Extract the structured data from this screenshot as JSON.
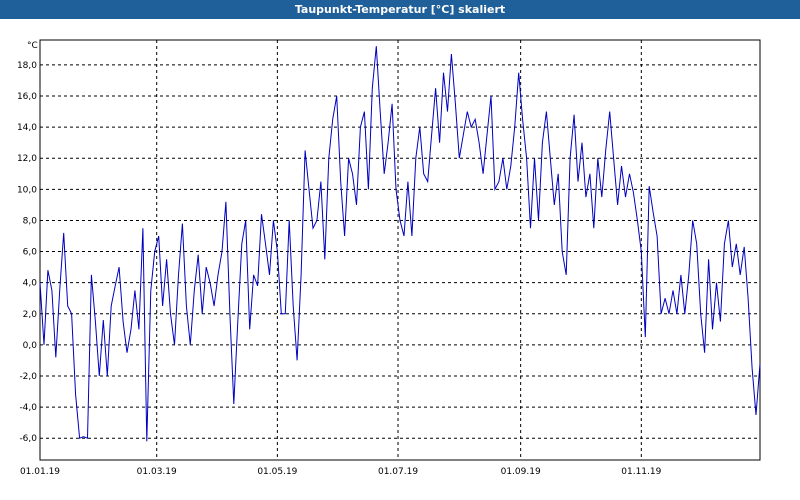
{
  "window": {
    "title": "Taupunkt-Temperatur [°C] skaliert"
  },
  "chart_data": {
    "type": "line",
    "title": "Taupunkt-Temperatur [°C] skaliert",
    "y_unit": "°C",
    "ylim": [
      -7.4,
      19.6
    ],
    "y_ticks": [
      "18,0",
      "16,0",
      "14,0",
      "12,0",
      "10,0",
      "8,0",
      "6,0",
      "4,0",
      "2,0",
      "0,0",
      "-2,0",
      "-4,0",
      "-6,0"
    ],
    "x_ticks": [
      "01.01.19",
      "01.03.19",
      "01.05.19",
      "01.07.19",
      "01.09.19",
      "01.11.19"
    ],
    "grid": true,
    "series": [
      {
        "color": "#0000c0",
        "points": [
          [
            "2019-01-01",
            4.0
          ],
          [
            "2019-01-03",
            0.0
          ],
          [
            "2019-01-05",
            4.8
          ],
          [
            "2019-01-07",
            3.5
          ],
          [
            "2019-01-09",
            -0.8
          ],
          [
            "2019-01-11",
            3.6
          ],
          [
            "2019-01-13",
            7.2
          ],
          [
            "2019-01-15",
            2.5
          ],
          [
            "2019-01-17",
            2.0
          ],
          [
            "2019-01-19",
            -3.2
          ],
          [
            "2019-01-21",
            -6.0
          ],
          [
            "2019-01-23",
            -5.9
          ],
          [
            "2019-01-25",
            -6.0
          ],
          [
            "2019-01-27",
            4.5
          ],
          [
            "2019-01-29",
            1.5
          ],
          [
            "2019-01-31",
            -2.0
          ],
          [
            "2019-02-02",
            1.6
          ],
          [
            "2019-02-04",
            -2.0
          ],
          [
            "2019-02-06",
            2.5
          ],
          [
            "2019-02-08",
            3.8
          ],
          [
            "2019-02-10",
            5.0
          ],
          [
            "2019-02-12",
            1.5
          ],
          [
            "2019-02-14",
            -0.5
          ],
          [
            "2019-02-16",
            1.0
          ],
          [
            "2019-02-18",
            3.5
          ],
          [
            "2019-02-20",
            1.0
          ],
          [
            "2019-02-22",
            7.5
          ],
          [
            "2019-02-24",
            -6.2
          ],
          [
            "2019-02-26",
            3.5
          ],
          [
            "2019-02-28",
            6.0
          ],
          [
            "2019-03-02",
            7.0
          ],
          [
            "2019-03-04",
            2.5
          ],
          [
            "2019-03-06",
            5.5
          ],
          [
            "2019-03-08",
            2.0
          ],
          [
            "2019-03-10",
            0.0
          ],
          [
            "2019-03-12",
            4.5
          ],
          [
            "2019-03-14",
            7.8
          ],
          [
            "2019-03-16",
            2.5
          ],
          [
            "2019-03-18",
            0.0
          ],
          [
            "2019-03-20",
            3.5
          ],
          [
            "2019-03-22",
            5.8
          ],
          [
            "2019-03-24",
            2.0
          ],
          [
            "2019-03-26",
            5.0
          ],
          [
            "2019-03-28",
            4.0
          ],
          [
            "2019-03-30",
            2.5
          ],
          [
            "2019-04-01",
            4.5
          ],
          [
            "2019-04-03",
            6.0
          ],
          [
            "2019-04-05",
            9.2
          ],
          [
            "2019-04-07",
            2.0
          ],
          [
            "2019-04-09",
            -3.8
          ],
          [
            "2019-04-11",
            1.5
          ],
          [
            "2019-04-13",
            6.5
          ],
          [
            "2019-04-15",
            8.0
          ],
          [
            "2019-04-17",
            1.0
          ],
          [
            "2019-04-19",
            4.5
          ],
          [
            "2019-04-21",
            3.8
          ],
          [
            "2019-04-23",
            8.4
          ],
          [
            "2019-04-25",
            6.5
          ],
          [
            "2019-04-27",
            4.5
          ],
          [
            "2019-04-29",
            8.0
          ],
          [
            "2019-05-01",
            6.0
          ],
          [
            "2019-05-03",
            2.0
          ],
          [
            "2019-05-05",
            2.0
          ],
          [
            "2019-05-07",
            8.0
          ],
          [
            "2019-05-09",
            2.5
          ],
          [
            "2019-05-11",
            -1.0
          ],
          [
            "2019-05-13",
            4.5
          ],
          [
            "2019-05-15",
            12.5
          ],
          [
            "2019-05-17",
            10.0
          ],
          [
            "2019-05-19",
            7.5
          ],
          [
            "2019-05-21",
            8.0
          ],
          [
            "2019-05-23",
            10.5
          ],
          [
            "2019-05-25",
            5.5
          ],
          [
            "2019-05-27",
            12.0
          ],
          [
            "2019-05-29",
            14.5
          ],
          [
            "2019-05-31",
            16.0
          ],
          [
            "2019-06-02",
            10.5
          ],
          [
            "2019-06-04",
            7.0
          ],
          [
            "2019-06-06",
            12.0
          ],
          [
            "2019-06-08",
            11.0
          ],
          [
            "2019-06-10",
            9.0
          ],
          [
            "2019-06-12",
            14.0
          ],
          [
            "2019-06-14",
            15.0
          ],
          [
            "2019-06-16",
            10.0
          ],
          [
            "2019-06-18",
            16.5
          ],
          [
            "2019-06-20",
            19.2
          ],
          [
            "2019-06-22",
            15.0
          ],
          [
            "2019-06-24",
            11.0
          ],
          [
            "2019-06-26",
            13.0
          ],
          [
            "2019-06-28",
            15.5
          ],
          [
            "2019-06-30",
            10.0
          ],
          [
            "2019-07-02",
            8.0
          ],
          [
            "2019-07-04",
            7.0
          ],
          [
            "2019-07-06",
            10.5
          ],
          [
            "2019-07-08",
            7.0
          ],
          [
            "2019-07-10",
            12.0
          ],
          [
            "2019-07-12",
            14.0
          ],
          [
            "2019-07-14",
            11.0
          ],
          [
            "2019-07-16",
            10.5
          ],
          [
            "2019-07-18",
            13.5
          ],
          [
            "2019-07-20",
            16.5
          ],
          [
            "2019-07-22",
            13.0
          ],
          [
            "2019-07-24",
            17.5
          ],
          [
            "2019-07-26",
            15.0
          ],
          [
            "2019-07-28",
            18.7
          ],
          [
            "2019-07-30",
            15.5
          ],
          [
            "2019-08-01",
            12.0
          ],
          [
            "2019-08-03",
            13.5
          ],
          [
            "2019-08-05",
            15.0
          ],
          [
            "2019-08-07",
            14.0
          ],
          [
            "2019-08-09",
            14.5
          ],
          [
            "2019-08-11",
            13.0
          ],
          [
            "2019-08-13",
            11.0
          ],
          [
            "2019-08-15",
            13.5
          ],
          [
            "2019-08-17",
            16.0
          ],
          [
            "2019-08-19",
            10.0
          ],
          [
            "2019-08-21",
            10.5
          ],
          [
            "2019-08-23",
            12.0
          ],
          [
            "2019-08-25",
            10.0
          ],
          [
            "2019-08-27",
            11.5
          ],
          [
            "2019-08-29",
            14.0
          ],
          [
            "2019-08-31",
            17.5
          ],
          [
            "2019-09-02",
            14.5
          ],
          [
            "2019-09-04",
            12.0
          ],
          [
            "2019-09-06",
            7.5
          ],
          [
            "2019-09-08",
            12.0
          ],
          [
            "2019-09-10",
            8.0
          ],
          [
            "2019-09-12",
            13.0
          ],
          [
            "2019-09-14",
            15.0
          ],
          [
            "2019-09-16",
            12.0
          ],
          [
            "2019-09-18",
            9.0
          ],
          [
            "2019-09-20",
            11.0
          ],
          [
            "2019-09-22",
            6.0
          ],
          [
            "2019-09-24",
            4.5
          ],
          [
            "2019-09-26",
            12.0
          ],
          [
            "2019-09-28",
            14.8
          ],
          [
            "2019-09-30",
            10.5
          ],
          [
            "2019-10-02",
            13.0
          ],
          [
            "2019-10-04",
            9.5
          ],
          [
            "2019-10-06",
            11.0
          ],
          [
            "2019-10-08",
            7.5
          ],
          [
            "2019-10-10",
            12.0
          ],
          [
            "2019-10-12",
            9.5
          ],
          [
            "2019-10-14",
            12.5
          ],
          [
            "2019-10-16",
            15.0
          ],
          [
            "2019-10-18",
            12.0
          ],
          [
            "2019-10-20",
            9.0
          ],
          [
            "2019-10-22",
            11.5
          ],
          [
            "2019-10-24",
            9.5
          ],
          [
            "2019-10-26",
            11.0
          ],
          [
            "2019-10-28",
            9.8
          ],
          [
            "2019-10-30",
            8.0
          ],
          [
            "2019-11-01",
            6.0
          ],
          [
            "2019-11-03",
            0.5
          ],
          [
            "2019-11-05",
            10.2
          ],
          [
            "2019-11-07",
            8.5
          ],
          [
            "2019-11-09",
            7.0
          ],
          [
            "2019-11-11",
            2.0
          ],
          [
            "2019-11-13",
            3.0
          ],
          [
            "2019-11-15",
            2.0
          ],
          [
            "2019-11-17",
            3.5
          ],
          [
            "2019-11-19",
            2.0
          ],
          [
            "2019-11-21",
            4.5
          ],
          [
            "2019-11-23",
            2.0
          ],
          [
            "2019-11-25",
            4.5
          ],
          [
            "2019-11-27",
            8.0
          ],
          [
            "2019-11-29",
            6.5
          ],
          [
            "2019-12-01",
            2.0
          ],
          [
            "2019-12-03",
            -0.5
          ],
          [
            "2019-12-05",
            5.5
          ],
          [
            "2019-12-07",
            1.0
          ],
          [
            "2019-12-09",
            4.0
          ],
          [
            "2019-12-11",
            1.5
          ],
          [
            "2019-12-13",
            6.5
          ],
          [
            "2019-12-15",
            8.0
          ],
          [
            "2019-12-17",
            5.0
          ],
          [
            "2019-12-19",
            6.5
          ],
          [
            "2019-12-21",
            4.5
          ],
          [
            "2019-12-23",
            6.3
          ],
          [
            "2019-12-25",
            3.0
          ],
          [
            "2019-12-27",
            -1.5
          ],
          [
            "2019-12-29",
            -4.5
          ],
          [
            "2019-12-31",
            -1.2
          ]
        ]
      }
    ]
  }
}
